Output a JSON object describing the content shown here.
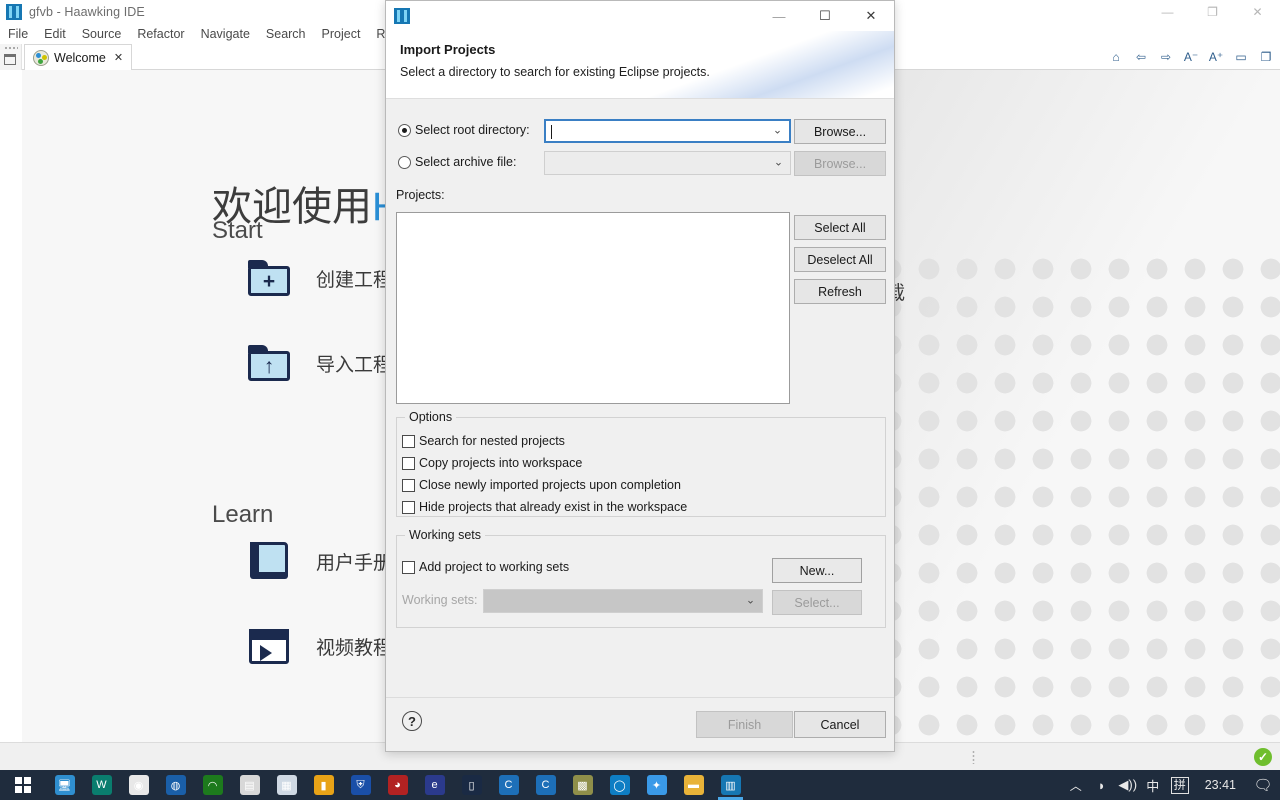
{
  "ide": {
    "title": "gfvb - Haawking IDE",
    "window_controls": [
      {
        "name": "minimize",
        "glyph": "—"
      },
      {
        "name": "restore",
        "glyph": "❐"
      },
      {
        "name": "close",
        "glyph": "✕"
      }
    ],
    "menu": [
      "File",
      "Edit",
      "Source",
      "Refactor",
      "Navigate",
      "Search",
      "Project",
      "Run"
    ],
    "tab": {
      "label": "Welcome",
      "close_glyph": "✕"
    },
    "view_tools": [
      {
        "name": "home-icon",
        "glyph": "⌂"
      },
      {
        "name": "back-arrow-icon",
        "glyph": "⇦"
      },
      {
        "name": "forward-arrow-icon",
        "glyph": "⇨"
      },
      {
        "name": "decrease-font-icon",
        "glyph": "A⁻"
      },
      {
        "name": "increase-font-icon",
        "glyph": "A⁺"
      },
      {
        "name": "minimize-view-icon",
        "glyph": "▭"
      },
      {
        "name": "maximize-view-icon",
        "glyph": "❐"
      }
    ],
    "welcome": {
      "title_cn": "欢迎使用",
      "title_accent": "H",
      "start_heading": "Start",
      "learn_heading": "Learn",
      "start_items": [
        {
          "label": "创建工程",
          "icon": "folder-plus-icon"
        },
        {
          "label": "导入工程",
          "icon": "folder-up-icon"
        }
      ],
      "learn_items": [
        {
          "label": "用户手册",
          "icon": "book-icon"
        },
        {
          "label": "视频教程",
          "icon": "video-icon"
        }
      ],
      "right_fragment": "载"
    }
  },
  "dialog": {
    "title_bar": {
      "controls": [
        {
          "name": "minimize",
          "glyph": "—"
        },
        {
          "name": "maximize",
          "glyph": "☐"
        },
        {
          "name": "close",
          "glyph": "✕"
        }
      ]
    },
    "heading": "Import Projects",
    "subheading": "Select a directory to search for existing Eclipse projects.",
    "source": {
      "root_directory": {
        "radio_label": "Select root directory:",
        "selected": true,
        "value": "",
        "browse_label": "Browse..."
      },
      "archive_file": {
        "radio_label": "Select archive file:",
        "selected": false,
        "value": "",
        "browse_label": "Browse...",
        "disabled": true
      }
    },
    "projects": {
      "label": "Projects:",
      "items": [],
      "buttons": [
        "Select All",
        "Deselect All",
        "Refresh"
      ]
    },
    "options": {
      "title": "Options",
      "checkboxes": [
        {
          "label": "Search for nested projects",
          "checked": false
        },
        {
          "label": "Copy projects into workspace",
          "checked": false
        },
        {
          "label": "Close newly imported projects upon completion",
          "checked": false
        },
        {
          "label": "Hide projects that already exist in the workspace",
          "checked": false
        }
      ]
    },
    "working_sets": {
      "title": "Working sets",
      "add_checkbox": {
        "label": "Add project to working sets",
        "checked": false
      },
      "new_button": "New...",
      "combo_label": "Working sets:",
      "combo_value": "",
      "select_button": "Select..."
    },
    "footer": {
      "help_glyph": "?",
      "finish_label": "Finish",
      "finish_disabled": true,
      "cancel_label": "Cancel"
    }
  },
  "taskbar": {
    "start_name": "start-button",
    "apps": [
      {
        "name": "this-pc-icon",
        "color": "#2f8fd0",
        "glyph": "🖥"
      },
      {
        "name": "wps-icon",
        "color": "#0a7d6e",
        "glyph": "W"
      },
      {
        "name": "chrome-icon",
        "color": "#e8e8e8",
        "glyph": "◉"
      },
      {
        "name": "player-icon",
        "color": "#1a5fa8",
        "glyph": "◍"
      },
      {
        "name": "loading-icon",
        "color": "#1d7a1d",
        "glyph": "◠"
      },
      {
        "name": "notepad-icon",
        "color": "#d8d8d8",
        "glyph": "▤"
      },
      {
        "name": "reader-icon",
        "color": "#cfd9e4",
        "glyph": "▦"
      },
      {
        "name": "folder-yellow-icon",
        "color": "#e8a317",
        "glyph": "▮"
      },
      {
        "name": "shield-icon",
        "color": "#1a4fa8",
        "glyph": "⛨"
      },
      {
        "name": "record-icon",
        "color": "#b22222",
        "glyph": "◕"
      },
      {
        "name": "edge-legacy-icon",
        "color": "#2b3a8c",
        "glyph": "e"
      },
      {
        "name": "panels-icon",
        "color": "#1a2a44",
        "glyph": "▯"
      },
      {
        "name": "ccs-icon-1",
        "color": "#1d6fb8",
        "glyph": "C"
      },
      {
        "name": "ccs-icon-2",
        "color": "#1d6fb8",
        "glyph": "C"
      },
      {
        "name": "chip-icon",
        "color": "#8f8f4a",
        "glyph": "▩"
      },
      {
        "name": "edge-icon",
        "color": "#0e7ec4",
        "glyph": "◯"
      },
      {
        "name": "bird-icon",
        "color": "#3a9ae8",
        "glyph": "✦"
      },
      {
        "name": "file-explorer-icon",
        "color": "#e8b339",
        "glyph": "▬"
      },
      {
        "name": "haawking-ide-icon",
        "color": "#1677b3",
        "glyph": "▥",
        "active": true
      }
    ],
    "tray": {
      "chevron": "︿",
      "wifi": "◗",
      "volume": "◀))",
      "ime": "中",
      "pinyin": "拼",
      "clock": "23:41",
      "notifications": "🗨"
    }
  }
}
